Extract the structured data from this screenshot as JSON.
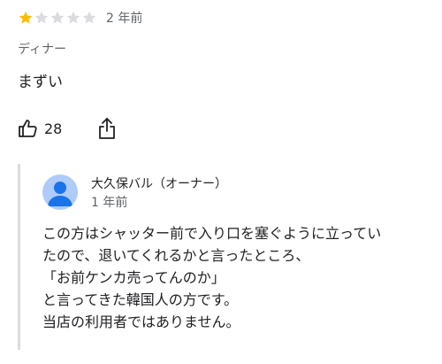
{
  "review": {
    "rating": 1,
    "rating_max": 5,
    "star_color_filled": "#fbbc04",
    "star_color_empty": "#dadce0",
    "relative_time": "2 年前",
    "meal_type": "ディナー",
    "text": "まずい",
    "like_count": "28",
    "like_icon": "thumbs-up-icon",
    "share_icon": "share-icon"
  },
  "owner_response": {
    "name": "大久保バル（オーナー）",
    "relative_time": "1 年前",
    "avatar_icon": "person-icon",
    "avatar_color": "#aecbfa",
    "lines": [
      "この方はシャッター前で入り口を塞ぐように立ってい",
      "たので、退いてくれるかと言ったところ、",
      "「お前ケンカ売ってんのか」",
      "と言ってきた韓国人の方です。",
      "当店の利用者ではありません。"
    ]
  }
}
